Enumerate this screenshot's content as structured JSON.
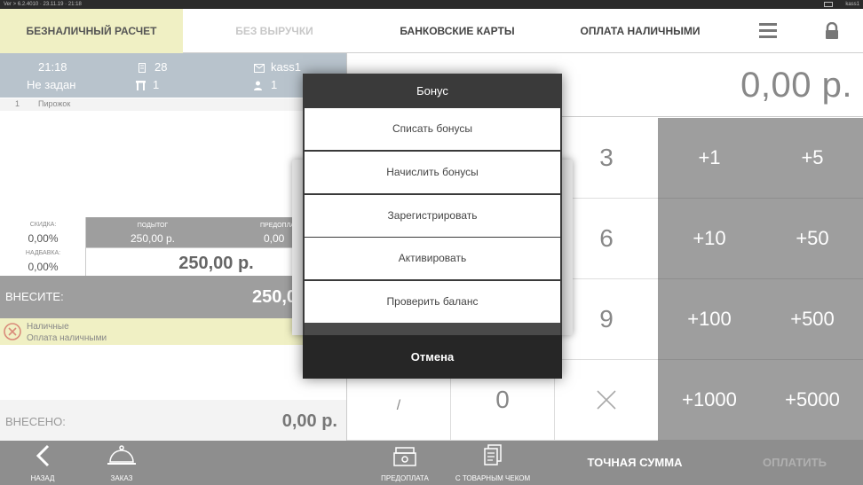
{
  "status_bar": {
    "version": "Ver > 6.2.4010 · 23.11.19 · 21:18",
    "user": "kass1"
  },
  "tabs": [
    {
      "label": "БЕЗНАЛИЧНЫЙ РАСЧЕТ",
      "state": "active"
    },
    {
      "label": "БЕЗ ВЫРУЧКИ",
      "state": "disabled"
    },
    {
      "label": "БАНКОВСКИЕ КАРТЫ",
      "state": "normal"
    },
    {
      "label": "ОПЛАТА НАЛИЧНЫМИ",
      "state": "normal"
    }
  ],
  "toolbar_icons": {
    "menu": "hamburger-icon",
    "lock": "lock-icon"
  },
  "order_info": {
    "time": "21:18",
    "table_no": "28",
    "cashier": "kass1",
    "waiter": "Не задан",
    "section": "1",
    "guests": "1"
  },
  "order_items": [
    {
      "num": "1",
      "name": "Пирожок"
    }
  ],
  "summary": {
    "discount_label": "СКИДКА:",
    "discount_value": "0,00%",
    "markup_label": "НАДБАВКА:",
    "markup_value": "0,00%",
    "subtotal_label": "ПОДЫТОГ",
    "subtotal_value": "250,00 р.",
    "prepay_label": "ПРЕДОПЛА",
    "prepay_value": "0,00",
    "total": "250,00 р."
  },
  "due": {
    "label": "ВНЕСИТЕ:",
    "value": "250,0"
  },
  "payment_line": {
    "type": "Наличные",
    "method": "Оплата наличными"
  },
  "paid": {
    "label": "ВНЕСЕНО:",
    "value": "0,00 р."
  },
  "amount_display": "0,00 р.",
  "keypad": {
    "digits": [
      "3",
      "6",
      "9"
    ],
    "bottom_row": [
      "/",
      "0"
    ],
    "quick_add": [
      "+1",
      "+5",
      "+10",
      "+50",
      "+100",
      "+500",
      "+1000",
      "+5000"
    ]
  },
  "bottom_bar": {
    "back": "НАЗАД",
    "order": "ЗАКАЗ",
    "prepay": "ПРЕДОПЛАТА",
    "receipt": "С ТОВАРНЫМ ЧЕКОМ",
    "exact": "ТОЧНАЯ СУММА",
    "pay": "ОПЛАТИТЬ"
  },
  "modal": {
    "title": "Бонус",
    "items": [
      "Списать бонусы",
      "Начислить бонусы",
      "Зарегистрировать",
      "Активировать",
      "Проверить баланс"
    ],
    "cancel": "Отмена"
  }
}
